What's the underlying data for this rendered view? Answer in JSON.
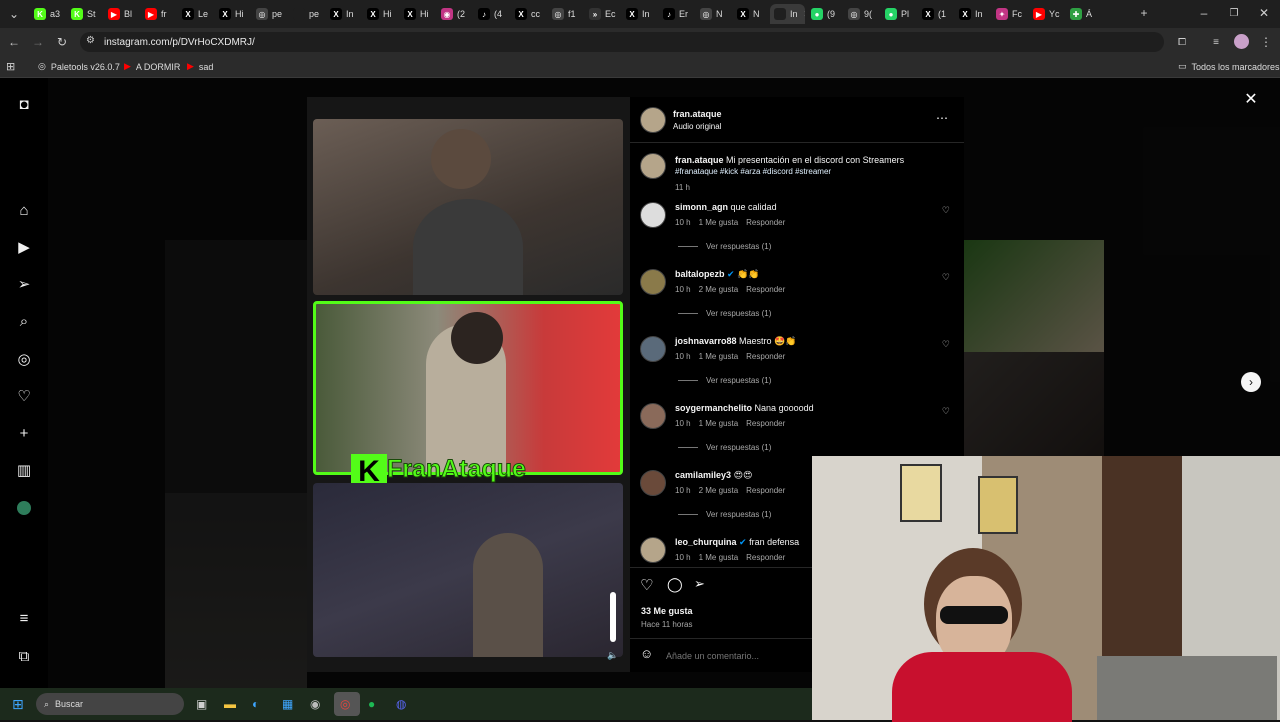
{
  "browser": {
    "tabs": [
      {
        "label": "a3",
        "fav": "K",
        "color": "#53fc18"
      },
      {
        "label": "St",
        "fav": "K",
        "color": "#53fc18"
      },
      {
        "label": "Bl",
        "fav": "▶",
        "color": "#ff0000"
      },
      {
        "label": "fr",
        "fav": "▶",
        "color": "#ff0000"
      },
      {
        "label": "Le",
        "fav": "X",
        "color": "#000000"
      },
      {
        "label": "Hi",
        "fav": "X",
        "color": "#000000"
      },
      {
        "label": "pe",
        "fav": "◎",
        "color": "#444444"
      },
      {
        "label": "pe",
        "fav": "",
        "color": "#1f1f1f"
      },
      {
        "label": "In",
        "fav": "X",
        "color": "#000000"
      },
      {
        "label": "Hi",
        "fav": "X",
        "color": "#000000"
      },
      {
        "label": "Hi",
        "fav": "X",
        "color": "#000000"
      },
      {
        "label": "(2",
        "fav": "◉",
        "color": "#c13584"
      },
      {
        "label": "(4",
        "fav": "♪",
        "color": "#000000"
      },
      {
        "label": "cc",
        "fav": "X",
        "color": "#000000"
      },
      {
        "label": "f1",
        "fav": "◎",
        "color": "#444444"
      },
      {
        "label": "Ec",
        "fav": "»",
        "color": "#333333"
      },
      {
        "label": "In",
        "fav": "X",
        "color": "#000000"
      },
      {
        "label": "Er",
        "fav": "♪",
        "color": "#000000"
      },
      {
        "label": "N",
        "fav": "◎",
        "color": "#444444"
      },
      {
        "label": "N",
        "fav": "X",
        "color": "#000000"
      },
      {
        "label": "In",
        "fav": "",
        "color": "#1f1f1f"
      },
      {
        "label": "(9",
        "fav": "●",
        "color": "#25d366"
      },
      {
        "label": "9(",
        "fav": "◎",
        "color": "#444444"
      },
      {
        "label": "Pl",
        "fav": "●",
        "color": "#25d366"
      },
      {
        "label": "(1",
        "fav": "X",
        "color": "#000000"
      },
      {
        "label": "In",
        "fav": "X",
        "color": "#000000"
      },
      {
        "label": "Fc",
        "fav": "✦",
        "color": "#c13584"
      },
      {
        "label": "Yc",
        "fav": "▶",
        "color": "#ff0000"
      },
      {
        "label": "Á",
        "fav": "✚",
        "color": "#2ea043"
      }
    ],
    "url": "instagram.com/p/DVrHoCXDMRJ/",
    "bookmarks": [
      {
        "label": "Paletools v26.0.7"
      },
      {
        "label": "A DORMIR"
      },
      {
        "label": "sad"
      }
    ],
    "all_bookmarks": "Todos los marcadores"
  },
  "post": {
    "author": "fran.ataque",
    "audio": "Audio original",
    "overlay_text": "FranAtaque",
    "caption": {
      "user": "fran.ataque",
      "text": "Mi presentación en el discord con Streamers",
      "hashtags": "#franataque #kick #arza #discord #streamer",
      "time": "11 h"
    },
    "comments": [
      {
        "user": "simonn_agn",
        "text": "que calidad",
        "time": "10 h",
        "likes": "1 Me gusta",
        "reply": "Responder",
        "replies": "Ver respuestas (1)",
        "verified": false,
        "avatar": "#dddddd"
      },
      {
        "user": "baltalopezb",
        "text": "👏👏",
        "time": "10 h",
        "likes": "2 Me gusta",
        "reply": "Responder",
        "replies": "Ver respuestas (1)",
        "verified": true,
        "avatar": "#8a7a4a"
      },
      {
        "user": "joshnavarro88",
        "text": "Maestro 🤩👏",
        "time": "10 h",
        "likes": "1 Me gusta",
        "reply": "Responder",
        "replies": "Ver respuestas (1)",
        "verified": false,
        "avatar": "#5a6a7a"
      },
      {
        "user": "soygermanchelito",
        "text": "Nana goooodd",
        "time": "10 h",
        "likes": "1 Me gusta",
        "reply": "Responder",
        "replies": "Ver respuestas (1)",
        "verified": false,
        "avatar": "#8a6a5a"
      },
      {
        "user": "camilamiley3",
        "text": "😍😍",
        "time": "10 h",
        "likes": "2 Me gusta",
        "reply": "Responder",
        "replies": "Ver respuestas (1)",
        "verified": false,
        "avatar": "#6a4a3a"
      },
      {
        "user": "leo_churquina",
        "text": "fran defensa",
        "time": "10 h",
        "likes": "1 Me gusta",
        "reply": "Responder",
        "replies": "",
        "verified": true,
        "avatar": "#b5a58a"
      }
    ],
    "likes": "33 Me gusta",
    "posted": "Hace 11 horas",
    "add_comment_placeholder": "Añade un comentario..."
  },
  "taskbar": {
    "search_placeholder": "Buscar"
  },
  "colors": {
    "kick_green": "#53fc18",
    "verified_blue": "#0095f6",
    "hashtag_blue": "#e0f1ff"
  }
}
